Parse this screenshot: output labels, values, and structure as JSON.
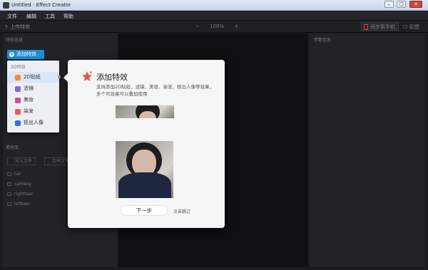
{
  "window": {
    "title": "Untitled - Effect Creator",
    "minimize": "–",
    "maximize": "□",
    "close": "✕"
  },
  "menu": [
    "文件",
    "编辑",
    "工具",
    "帮助"
  ],
  "toolbar": {
    "upload": "上传特效",
    "zoom_out": "−",
    "zoom_value": "100%",
    "zoom_in": "+",
    "sync_phone": "同步到手机",
    "feedback": "反馈"
  },
  "left_panel": {
    "effects_header": "特效信息",
    "add_button": "添加特效",
    "dropdown": {
      "header": "2D特效",
      "items": [
        {
          "label": "2D贴纸",
          "icon": "sticker-icon",
          "color": "#f28c2e"
        },
        {
          "label": "滤镜",
          "icon": "filter-icon",
          "color": "#7f6be0"
        },
        {
          "label": "美妆",
          "icon": "makeup-icon",
          "color": "#d24f86"
        },
        {
          "label": "染发",
          "icon": "hair-dye-icon",
          "color": "#ef5a53"
        },
        {
          "label": "抠出人像",
          "icon": "portrait-cutout-icon",
          "color": "#3f6fd6"
        }
      ]
    },
    "assets_header": "素材库",
    "import_button": "导入文件",
    "new_folder_button": "合并文件",
    "assets": [
      "tail",
      "caiheng",
      "righttear",
      "lefttear"
    ]
  },
  "right_panel": {
    "header": "参数信息"
  },
  "modal": {
    "title": "添加特效",
    "description": "支持添加2D贴纸、滤镜、美妆、染发、抠出人像等效果，多个可效果可以叠加使用",
    "next_button": "下一步",
    "skip_link": "点击跳过",
    "accent": "#e5534b"
  }
}
